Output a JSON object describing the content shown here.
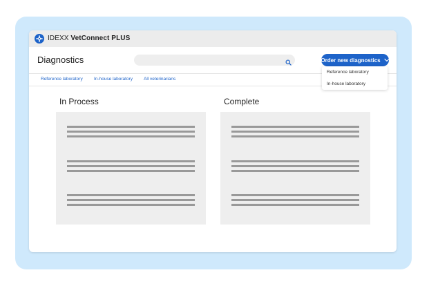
{
  "colors": {
    "accent": "#1d63c9",
    "frame": "#cfe9fc",
    "card": "#eeeeee",
    "placeholder_line": "#999999"
  },
  "app": {
    "title_prefix": "IDEXX",
    "title_product": "VetConnect PLUS",
    "logo_icon": "idexx-logo-icon"
  },
  "header": {
    "page_title": "Diagnostics",
    "search": {
      "value": "",
      "placeholder": "",
      "icon": "search-icon"
    },
    "order_button": {
      "label": "Order new diagnostics",
      "icon": "chevron-down-icon"
    }
  },
  "dropdown": {
    "items": [
      "Reference laboratory",
      "In-house laboratory"
    ]
  },
  "nav": {
    "tabs": [
      "Reference laboratory",
      "In-house laboratory",
      "All veterinarians"
    ]
  },
  "sections": [
    {
      "title": "In Process"
    },
    {
      "title": "Complete"
    }
  ]
}
